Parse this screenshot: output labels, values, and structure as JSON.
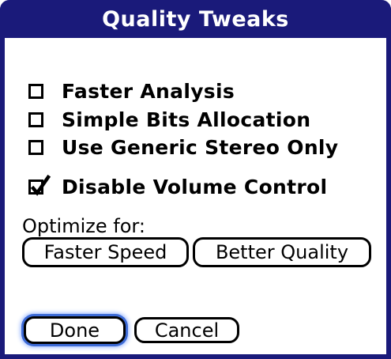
{
  "dialog": {
    "title": "Quality Tweaks"
  },
  "options": [
    {
      "label": "Faster Analysis",
      "checked": false
    },
    {
      "label": "Simple Bits Allocation",
      "checked": false
    },
    {
      "label": "Use Generic Stereo Only",
      "checked": false
    },
    {
      "label": "Disable Volume Control",
      "checked": true
    }
  ],
  "optimize": {
    "label": "Optimize for:",
    "faster_speed": "Faster Speed",
    "better_quality": "Better Quality"
  },
  "actions": {
    "done": "Done",
    "cancel": "Cancel"
  },
  "colors": {
    "titlebar": "#1a1a7a",
    "focus_ring": "#3d6bd6"
  }
}
